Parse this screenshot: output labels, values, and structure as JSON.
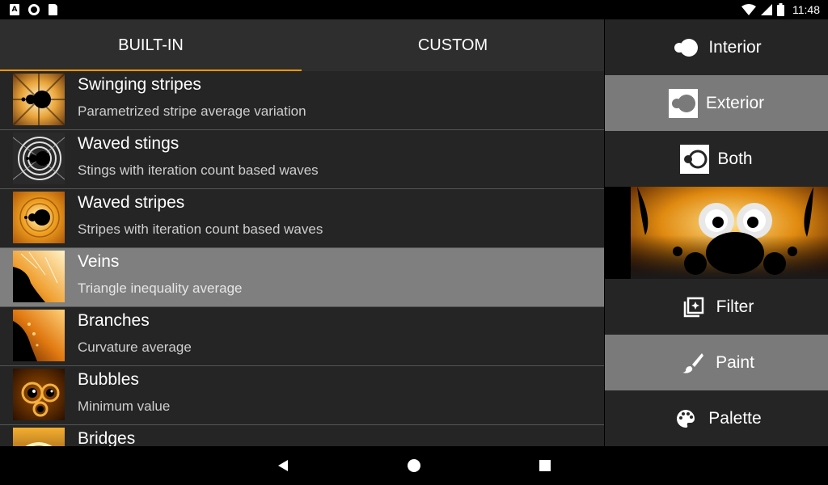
{
  "status_bar": {
    "notif_a": "A",
    "time": "11:48"
  },
  "tabs": [
    {
      "label": "BUILT-IN",
      "selected": true
    },
    {
      "label": "CUSTOM",
      "selected": false
    }
  ],
  "items": [
    {
      "title": "Swinging stripes",
      "subtitle": "Parametrized stripe average variation",
      "thumb": "mandelbrot-gold"
    },
    {
      "title": "Waved stings",
      "subtitle": "Stings with iteration count based waves",
      "thumb": "mandelbrot-gray"
    },
    {
      "title": "Waved stripes",
      "subtitle": "Stripes with iteration count based waves",
      "thumb": "mandelbrot-gold"
    },
    {
      "title": "Veins",
      "subtitle": "Triangle inequality average",
      "thumb": "veins",
      "selected": true
    },
    {
      "title": "Branches",
      "subtitle": "Curvature average",
      "thumb": "branches"
    },
    {
      "title": "Bubbles",
      "subtitle": "Minimum value",
      "thumb": "bubbles"
    },
    {
      "title": "Bridges",
      "subtitle": "",
      "thumb": "bridges"
    }
  ],
  "right_panel": {
    "interior": "Interior",
    "exterior": "Exterior",
    "both": "Both",
    "filter": "Filter",
    "paint": "Paint",
    "palette": "Palette",
    "active": [
      "exterior",
      "paint"
    ]
  },
  "colors": {
    "accent": "#ff9800",
    "background": "#252525",
    "selected": "#7f7f7f"
  }
}
